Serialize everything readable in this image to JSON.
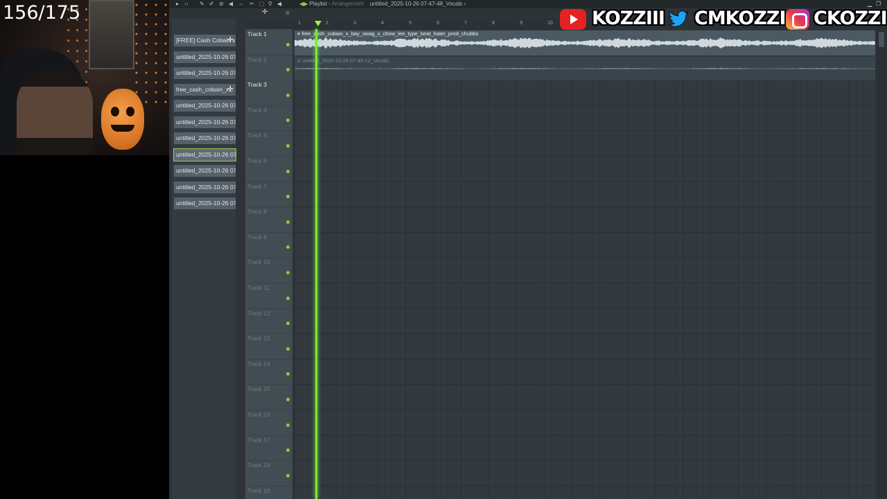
{
  "overlay": {
    "counter": "156/175",
    "social": [
      {
        "icon": "youtube-icon",
        "text": "KOZZIII",
        "color": "#e52222"
      },
      {
        "icon": "twitter-icon",
        "text": "CMKOZZI",
        "color": "#1da1f2"
      },
      {
        "icon": "instagram-icon",
        "text": "CKOZZI",
        "color": "#e7354d"
      }
    ]
  },
  "window": {
    "title_prefix": "Playlist - ",
    "title_mode": "Arrangement",
    "title_pattern": "untitled_2025-10-26 07-47-48_Vocals ›"
  },
  "picker": {
    "items": [
      {
        "label": "[FREE] Cash Cobain x...",
        "plus": "✛"
      },
      {
        "label": "untitled_2025-10-26 07-..."
      },
      {
        "label": "untitled_2025-10-26 07-..."
      },
      {
        "label": "free_cash_cobain_x...",
        "plus": "✛"
      },
      {
        "label": "untitled_2025-10-26 07-..."
      },
      {
        "label": "untitled_2025-10-26 07-..."
      },
      {
        "label": "untitled_2025-10-26 07-..."
      },
      {
        "label": "untitled_2025-10-26 07-..."
      },
      {
        "label": "untitled_2025-10-26 07-..."
      },
      {
        "label": "untitled_2025-10-26 07-..."
      },
      {
        "label": "untitled_2025-10-26 07-..."
      }
    ],
    "selected_index": 7
  },
  "ruler": [
    "1",
    "2",
    "3",
    "4",
    "5",
    "6",
    "7",
    "8",
    "9",
    "10"
  ],
  "tracks": [
    {
      "name": "Track 1",
      "active": true
    },
    {
      "name": "Track 2",
      "active": false
    },
    {
      "name": "Track 3",
      "active": true
    },
    {
      "name": "Track 4",
      "active": false
    },
    {
      "name": "Track 5",
      "active": false
    },
    {
      "name": "Track 6",
      "active": false
    },
    {
      "name": "Track 7",
      "active": false
    },
    {
      "name": "Track 8",
      "active": false
    },
    {
      "name": "Track 9",
      "active": false
    },
    {
      "name": "Track 10",
      "active": false
    },
    {
      "name": "Track 11",
      "active": false
    },
    {
      "name": "Track 12",
      "active": false
    },
    {
      "name": "Track 13",
      "active": false
    },
    {
      "name": "Track 14",
      "active": false
    },
    {
      "name": "Track 15",
      "active": false
    },
    {
      "name": "Track 16",
      "active": false
    },
    {
      "name": "Track 17",
      "active": false
    },
    {
      "name": "Track 18",
      "active": false
    },
    {
      "name": "Track 19",
      "active": false
    }
  ],
  "clips": {
    "clip1_label": "≡ free_cash_cobain_x_bay_swag_x_chow_lee_type_beat_hater_prod_chubbs",
    "clip2_label": "X untitled_2025-10-26 07-48-12_Vocals"
  }
}
